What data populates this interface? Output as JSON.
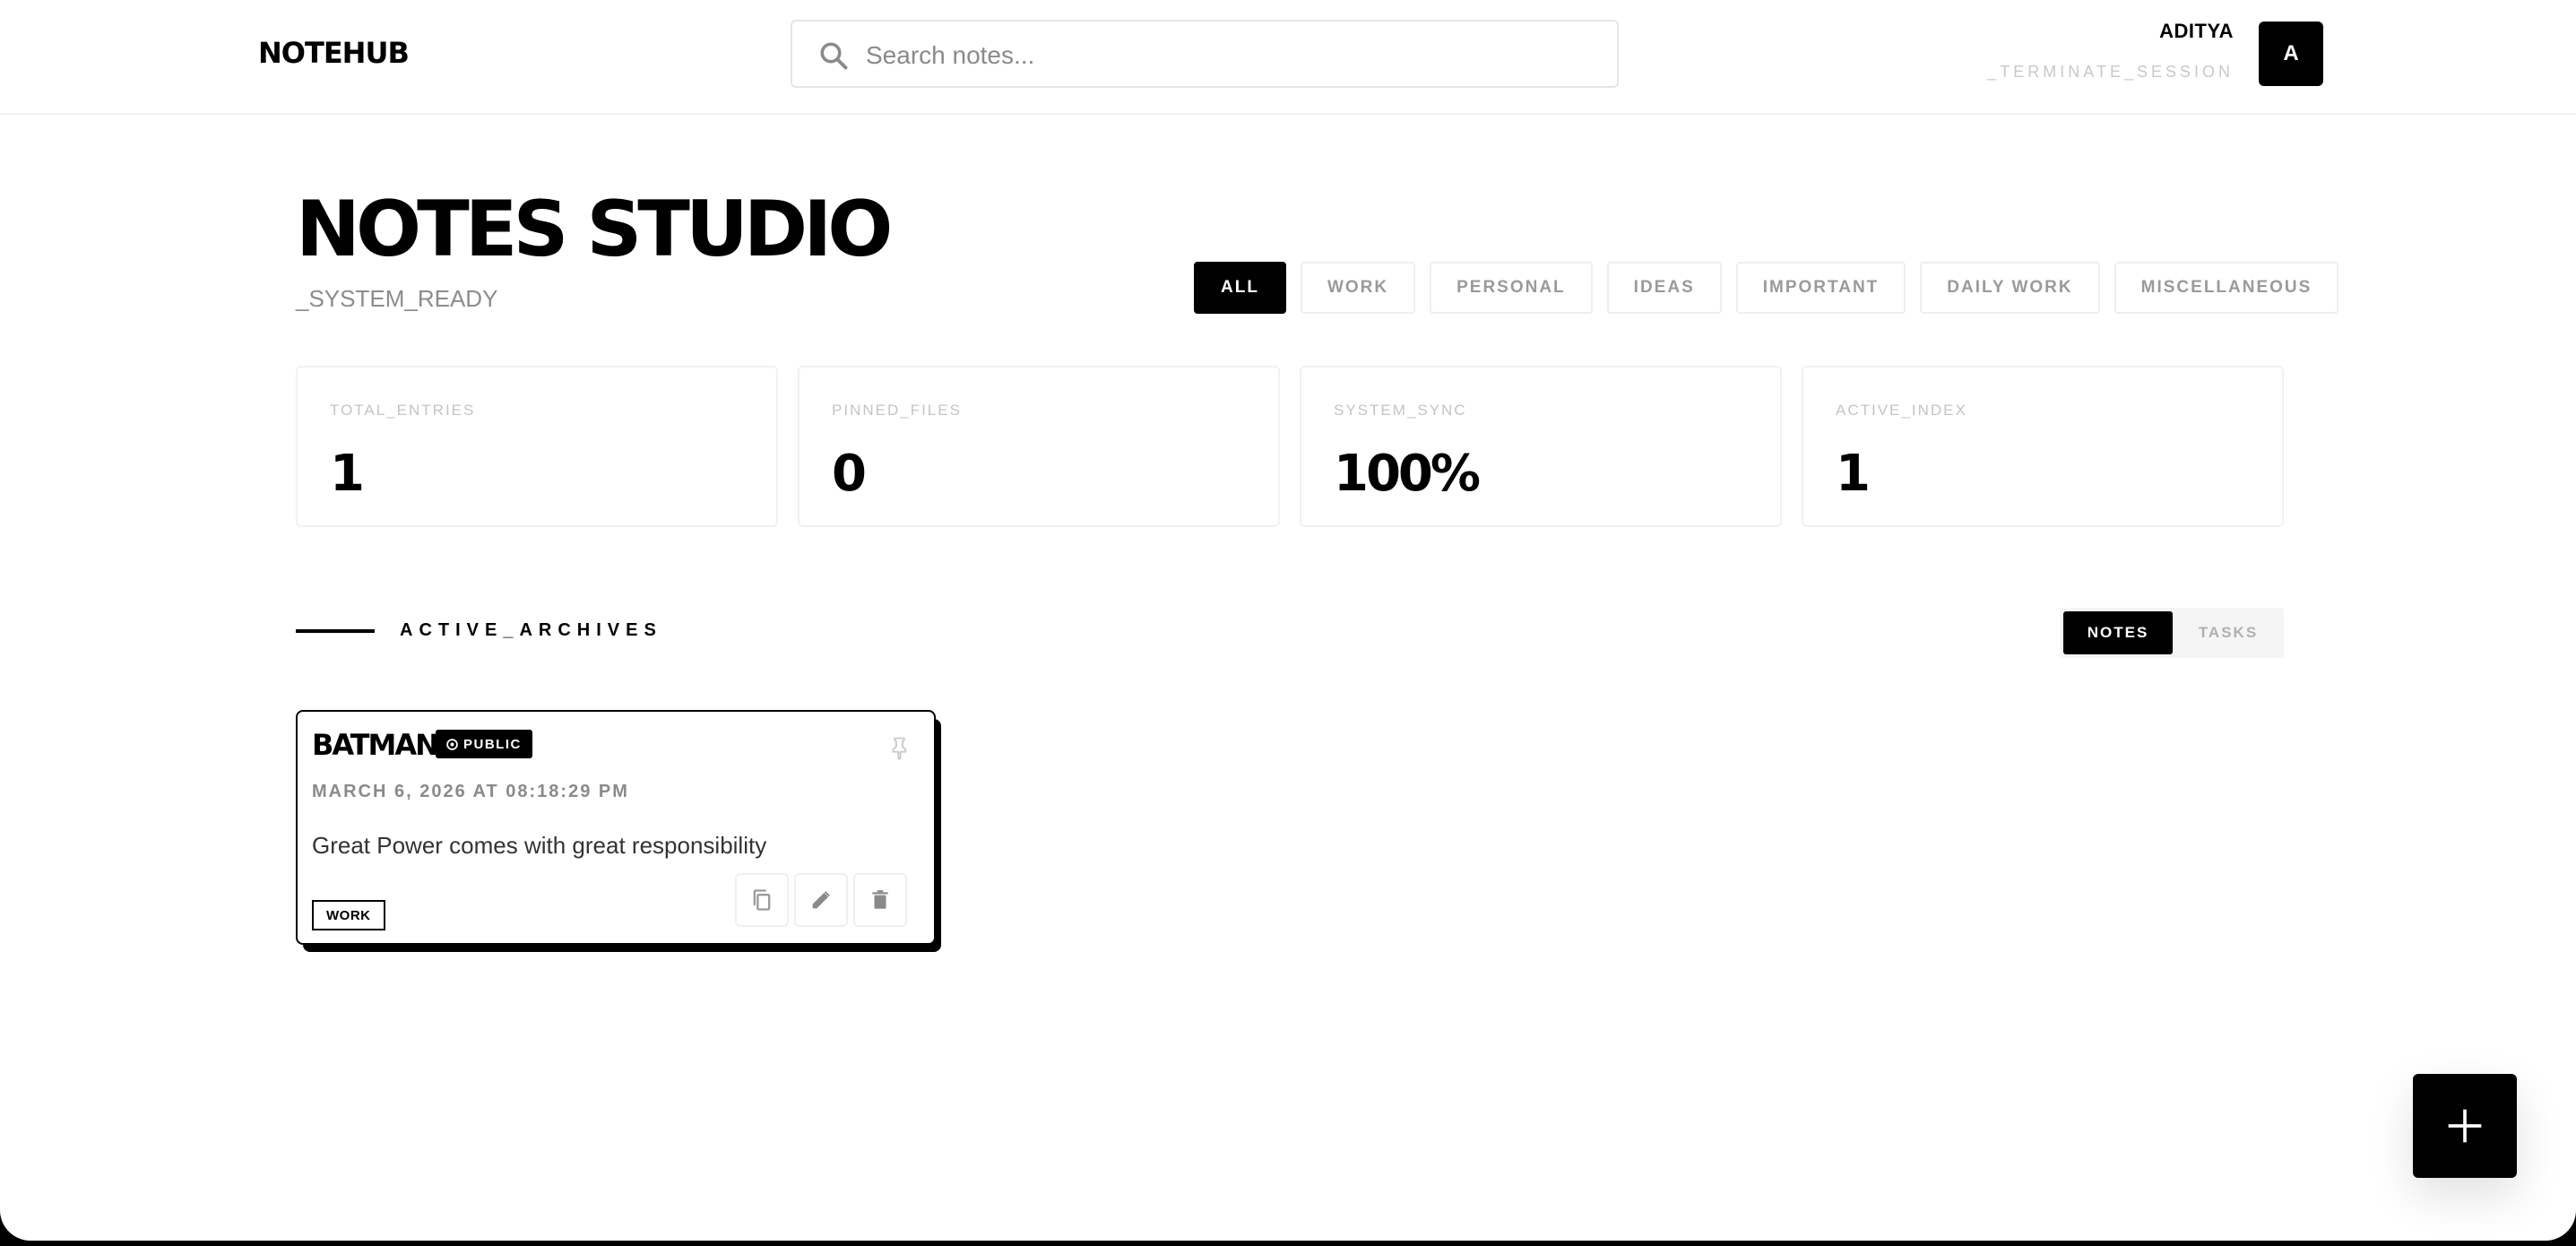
{
  "header": {
    "logo": "NOTEHUB",
    "search_placeholder": "Search notes...",
    "user_name": "ADITYA",
    "terminate_label": "_TERMINATE_SESSION",
    "avatar_initial": "A"
  },
  "page": {
    "title": "NOTES STUDIO",
    "subtitle": "_SYSTEM_READY"
  },
  "filters": [
    "ALL",
    "WORK",
    "PERSONAL",
    "IDEAS",
    "IMPORTANT",
    "DAILY WORK",
    "MISCELLANEOUS"
  ],
  "active_filter": "ALL",
  "stats": [
    {
      "label": "TOTAL_ENTRIES",
      "value": "1"
    },
    {
      "label": "PINNED_FILES",
      "value": "0"
    },
    {
      "label": "SYSTEM_SYNC",
      "value": "100%"
    },
    {
      "label": "ACTIVE_INDEX",
      "value": "1"
    }
  ],
  "section": {
    "title": "ACTIVE_ARCHIVES",
    "toggle_notes": "NOTES",
    "toggle_tasks": "TASKS",
    "active_toggle": "NOTES"
  },
  "notes": [
    {
      "title": "BATMAN",
      "visibility": "PUBLIC",
      "date": "MARCH 6, 2026 AT 08:18:29 PM",
      "body": "Great Power comes with great responsibility",
      "tag": "WORK"
    }
  ],
  "icons": {
    "search": "search-icon",
    "pin": "pin-icon",
    "copy": "copy-icon",
    "edit": "pencil-icon",
    "delete": "trash-icon",
    "add": "plus-icon",
    "public": "globe-icon"
  },
  "colors": {
    "accent": "#000000",
    "muted": "#8a8a8a",
    "border": "#efefef"
  }
}
